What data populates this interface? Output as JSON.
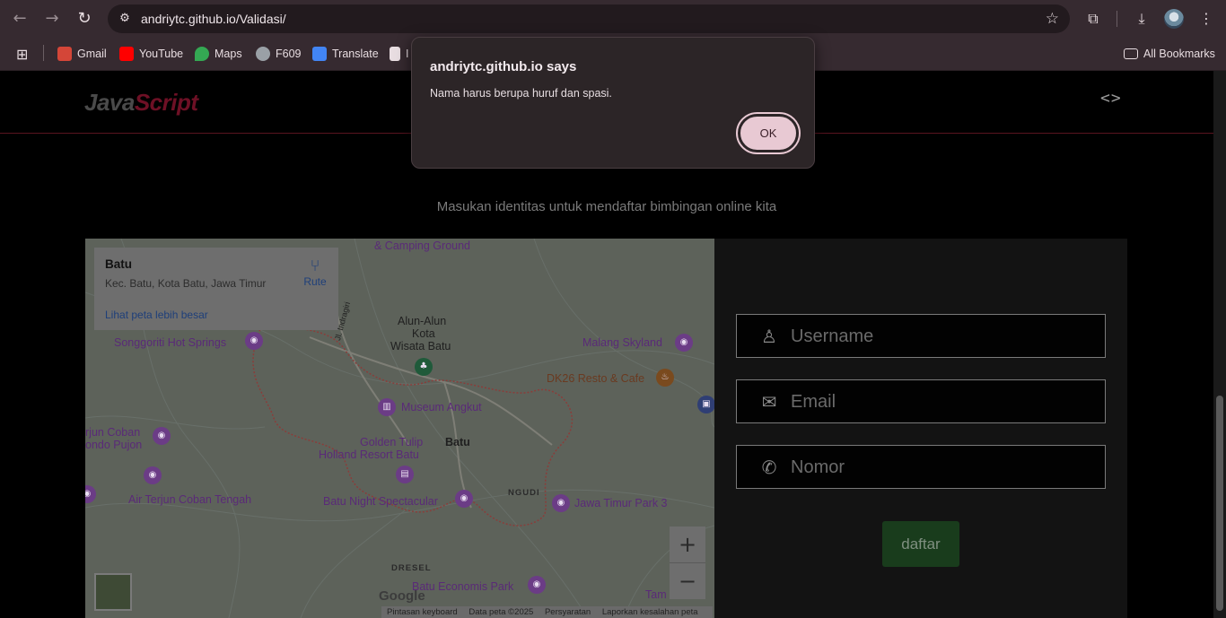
{
  "browser": {
    "url": "andriytc.github.io/Validasi/",
    "bookmarks": [
      {
        "label": "Gmail",
        "color": "#d44638"
      },
      {
        "label": "YouTube",
        "color": "#ff0000"
      },
      {
        "label": "Maps",
        "color": "#34a853"
      },
      {
        "label": "F609",
        "color": "#9aa0a6"
      },
      {
        "label": "Translate",
        "color": "#4285f4"
      },
      {
        "label": "I",
        "color": "#e8dde1"
      }
    ],
    "all_bookmarks": "All Bookmarks"
  },
  "site": {
    "logo_part1": "Java",
    "logo_part2": "Script",
    "subtitle": "Masukan identitas untuk mendaftar bimbingan online kita"
  },
  "map": {
    "card": {
      "title": "Batu",
      "address": "Kec. Batu, Kota Batu, Jawa Timur",
      "route": "Rute",
      "view_larger": "Lihat peta lebih besar"
    },
    "labels": {
      "camping": "& Camping Ground",
      "songgoriti": "Songgoriti Hot Springs",
      "jl_indragiri": "Jl. Indragiri",
      "alun1": "Alun-Alun",
      "alun2": "Kota",
      "alun3": "Wisata Batu",
      "malang_skyland": "Malang Skyland",
      "dk26": "DK26 Resto & Cafe",
      "museum": "Museum Angkut",
      "coban1": "rjun Coban",
      "coban2": "ondo Pujon",
      "golden1": "Golden Tulip",
      "golden2": "Holland Resort Batu",
      "batu": "Batu",
      "ngudi": "NGUDI",
      "air_terjun": "Air Terjun Coban Tengah",
      "night": "Batu Night Spectacular",
      "jatim3": "Jawa Timur Park 3",
      "dresel": "DRESEL",
      "economis": "Batu Economis Park",
      "tam": "Tam",
      "google": "Google"
    },
    "attribution": [
      "Pintasan keyboard",
      "Data peta ©2025",
      "Persyaratan",
      "Laporkan kesalahan peta"
    ],
    "zoom_in": "+",
    "zoom_out": "−"
  },
  "form": {
    "username_placeholder": "Username",
    "email_placeholder": "Email",
    "nomor_placeholder": "Nomor",
    "submit": "daftar"
  },
  "dialog": {
    "title": "andriytc.github.io says",
    "message": "Nama harus berupa huruf dan spasi.",
    "ok": "OK"
  }
}
